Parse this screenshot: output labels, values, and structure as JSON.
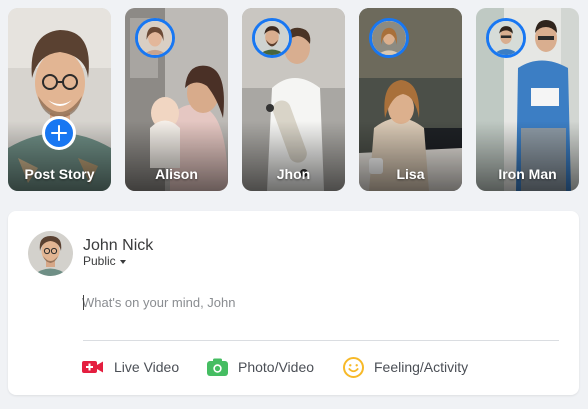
{
  "stories": [
    {
      "label": "Post Story"
    },
    {
      "label": "Alison"
    },
    {
      "label": "Jhon"
    },
    {
      "label": "Lisa"
    },
    {
      "label": "Iron Man"
    }
  ],
  "composer": {
    "user_name": "John Nick",
    "audience": "Public",
    "placeholder": "What's on your mind, John",
    "actions": [
      {
        "label": "Live Video",
        "icon": "live-video-icon",
        "color": "#e41e3f"
      },
      {
        "label": "Photo/Video",
        "icon": "photo-icon",
        "color": "#45bd62"
      },
      {
        "label": "Feeling/Activity",
        "icon": "feeling-icon",
        "color": "#f7b928"
      }
    ]
  },
  "colors": {
    "accent": "#1877f2",
    "background": "#f0f2f5"
  }
}
